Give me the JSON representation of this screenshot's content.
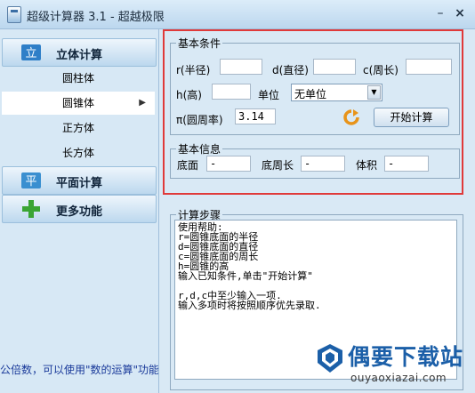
{
  "window": {
    "title": "超级计算器 3.1 - 超越极限",
    "minimize": "–",
    "close": "×"
  },
  "sidebar": {
    "groups": [
      {
        "label": "立体计算"
      },
      {
        "label": "平面计算"
      },
      {
        "label": "更多功能"
      }
    ],
    "items": [
      {
        "label": "圆柱体"
      },
      {
        "label": "圆锥体",
        "selected": true
      },
      {
        "label": "正方体"
      },
      {
        "label": "长方体"
      }
    ],
    "marquee": "公倍数，可以使用\"数的运算\"功能"
  },
  "basic_conditions": {
    "legend": "基本条件",
    "radius_label": "r(半径)",
    "radius_value": "",
    "diameter_label": "d(直径)",
    "diameter_value": "",
    "circumference_label": "c(周长)",
    "circumference_value": "",
    "height_label": "h(高)",
    "height_value": "",
    "unit_label": "单位",
    "unit_value": "无单位",
    "pi_label": "π(圆周率)",
    "pi_value": "3.14",
    "start_button": "开始计算"
  },
  "basic_info": {
    "legend": "基本信息",
    "base_area_label": "底面",
    "base_area_value": "-",
    "base_perimeter_label": "底周长",
    "base_perimeter_value": "-",
    "volume_label": "体积",
    "volume_value": "-"
  },
  "steps": {
    "legend": "计算步骤",
    "text": "使用帮助:\nr=圆锥底面的半径\nd=圆锥底面的直径\nc=圆锥底面的周长\nh=圆锥的高\n输入已知条件,单击\"开始计算\"\n\nr,d,c中至少输入一项.\n输入多项时将按照顺序优先录取."
  },
  "watermark": {
    "title": "偶要下载站",
    "url": "ouyaoxiazai.com"
  },
  "colors": {
    "accent_red": "#e03a3a",
    "panel": "#d9e9f5",
    "brand_blue": "#1b5fa8"
  }
}
